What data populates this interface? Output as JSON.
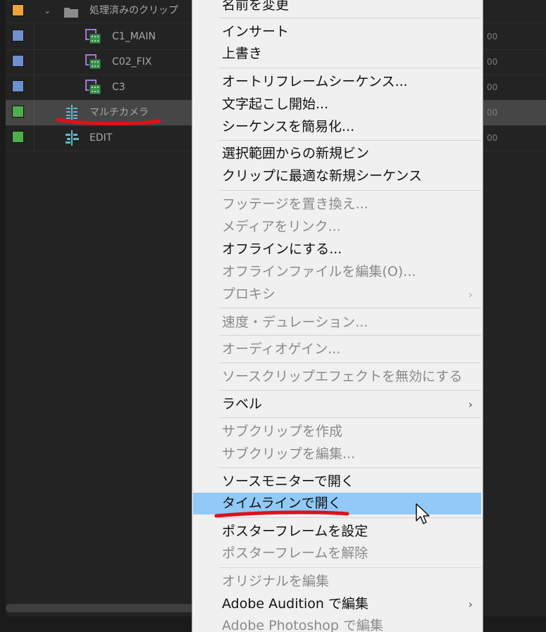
{
  "project_panel": {
    "rows": [
      {
        "name": "処理済みのクリップ",
        "color": "#f0a23c",
        "kind": "folder",
        "value": ""
      },
      {
        "name": "C1_MAIN",
        "color": "#6f8fcf",
        "kind": "clip",
        "value": "00"
      },
      {
        "name": "C02_FIX",
        "color": "#6f8fcf",
        "kind": "clip",
        "value": "00"
      },
      {
        "name": "C3",
        "color": "#6f8fcf",
        "kind": "clip",
        "value": "00"
      },
      {
        "name": "マルチカメラ",
        "color": "#4fae4c",
        "kind": "multicam",
        "value": "00"
      },
      {
        "name": "EDIT",
        "color": "#4fae4c",
        "kind": "sequence",
        "value": "00"
      }
    ],
    "accent_colors": {
      "annotation_red": "#e0101a"
    }
  },
  "context_menu": {
    "items": [
      {
        "label": "名前を変更",
        "enabled": true
      },
      {
        "label": "インサート",
        "enabled": true
      },
      {
        "label": "上書き",
        "enabled": true
      },
      {
        "label": "オートリフレームシーケンス...",
        "enabled": true
      },
      {
        "label": "文字起こし開始...",
        "enabled": true
      },
      {
        "label": "シーケンスを簡易化...",
        "enabled": true
      },
      {
        "label": "選択範囲からの新規ビン",
        "enabled": true
      },
      {
        "label": "クリップに最適な新規シーケンス",
        "enabled": true
      },
      {
        "label": "フッテージを置き換え...",
        "enabled": false
      },
      {
        "label": "メディアをリンク...",
        "enabled": false
      },
      {
        "label": "オフラインにする...",
        "enabled": true
      },
      {
        "label": "オフラインファイルを編集(O)...",
        "enabled": false
      },
      {
        "label": "プロキシ",
        "enabled": false,
        "submenu": true
      },
      {
        "label": "速度・デュレーション...",
        "enabled": false
      },
      {
        "label": "オーディオゲイン...",
        "enabled": false
      },
      {
        "label": "ソースクリップエフェクトを無効にする",
        "enabled": false
      },
      {
        "label": "ラベル",
        "enabled": true,
        "submenu": true
      },
      {
        "label": "サブクリップを作成",
        "enabled": false
      },
      {
        "label": "サブクリップを編集...",
        "enabled": false
      },
      {
        "label": "ソースモニターで開く",
        "enabled": true
      },
      {
        "label": "タイムラインで開く",
        "enabled": true,
        "highlighted": true
      },
      {
        "label": "ポスターフレームを設定",
        "enabled": true
      },
      {
        "label": "ポスターフレームを解除",
        "enabled": false
      },
      {
        "label": "オリジナルを編集",
        "enabled": false
      },
      {
        "label": "Adobe Audition で編集",
        "enabled": true,
        "submenu": true
      },
      {
        "label": "Adobe Photoshop で編集",
        "enabled": false
      }
    ],
    "submenu_arrow": "›",
    "highlight_color": "#91c9f7"
  }
}
